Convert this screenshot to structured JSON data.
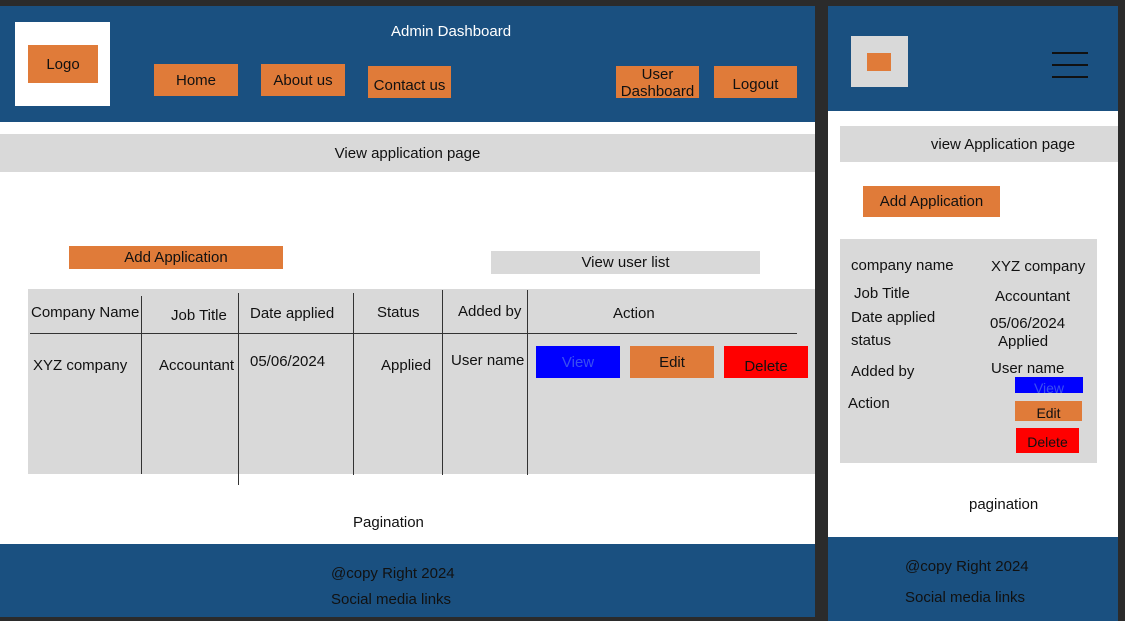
{
  "desktop": {
    "header": {
      "logo_label": "Logo",
      "title": "Admin Dashboard",
      "nav": {
        "home": "Home",
        "about": "About us",
        "contact": "Contact us",
        "user_dashboard_line1": "User",
        "user_dashboard_line2": "Dashboard",
        "logout": "Logout"
      }
    },
    "page_banner": "View application page",
    "add_application": "Add Application",
    "view_user_list": "View user list",
    "table": {
      "headers": {
        "company": "Company Name",
        "job": "Job Title",
        "date": "Date applied",
        "status": "Status",
        "added_by": "Added by",
        "action": "Action"
      },
      "row": {
        "company": "XYZ company",
        "job": "Accountant",
        "date": "05/06/2024",
        "status": "Applied",
        "added_by": "User name"
      },
      "actions": {
        "view": "View",
        "edit": "Edit",
        "delete": "Delete"
      }
    },
    "pagination": "Pagination",
    "footer": {
      "copyright": "@copy Right 2024",
      "social": "Social media links"
    }
  },
  "mobile": {
    "page_banner": "view Application page",
    "add_application": "Add Application",
    "card": {
      "company_label": "company name",
      "company_value": "XYZ company",
      "job_label": "Job Title",
      "job_value": "Accountant",
      "date_label": "Date applied",
      "date_value": "05/06/2024",
      "status_label": "status",
      "status_value": "Applied",
      "added_by_label": "Added by",
      "added_by_value": "User name",
      "action_label": "Action",
      "view": "View",
      "edit": "Edit",
      "delete": "Delete"
    },
    "pagination": "pagination",
    "footer": {
      "copyright": "@copy Right 2024",
      "social": "Social media links"
    }
  },
  "colors": {
    "navy": "#1a5080",
    "orange": "#e07b39",
    "grey": "#d9d9d9",
    "view_blue": "#0000ff",
    "delete_red": "#ff0000"
  }
}
